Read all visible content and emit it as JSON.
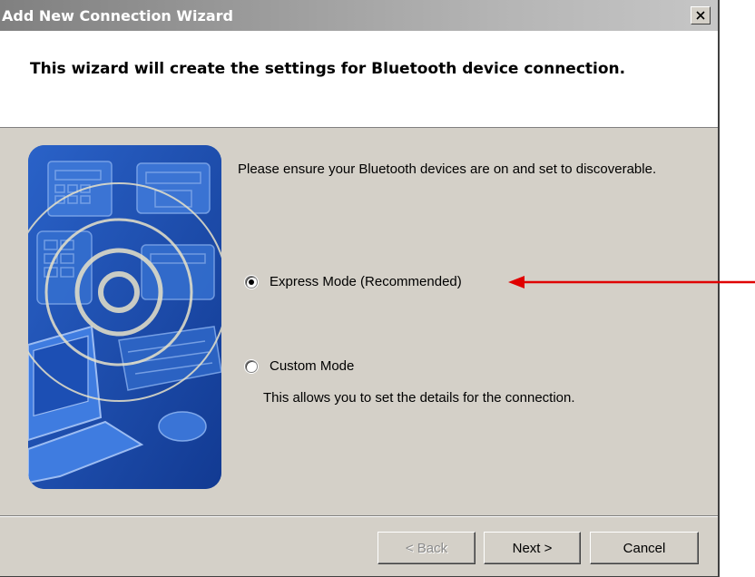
{
  "window": {
    "title": "Add New Connection Wizard",
    "close_icon": "close-icon"
  },
  "header": {
    "text": "This wizard will create the settings for Bluetooth device connection."
  },
  "main": {
    "intro": "Please ensure your Bluetooth devices are on and set to discoverable.",
    "options": [
      {
        "label": "Express Mode (Recommended)",
        "selected": true
      },
      {
        "label": "Custom Mode",
        "selected": false,
        "description": "This allows you to set the details for the connection."
      }
    ],
    "illustration_icon": "office-devices-bluetooth-illustration"
  },
  "footer": {
    "back_label": "< Back",
    "back_enabled": false,
    "next_label": "Next >",
    "cancel_label": "Cancel"
  },
  "annotation": {
    "arrow_color": "#e00000"
  }
}
